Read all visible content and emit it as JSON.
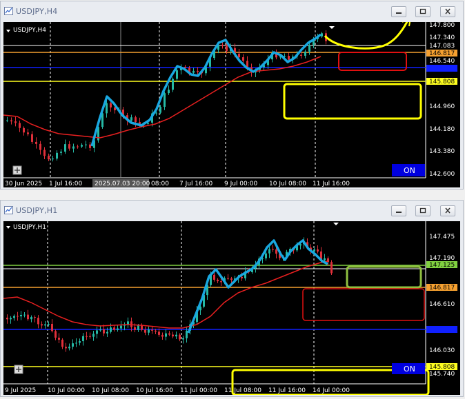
{
  "window1": {
    "title": "USDJPY,H4",
    "symbol": "USDJPY,H4",
    "on_badge": "ON",
    "price_labels": [
      "147.800",
      "147.340",
      "147.083",
      "146.817",
      "146.540",
      "145.808",
      "144.960",
      "144.180",
      "143.380",
      "142.600"
    ],
    "time_labels": [
      "30 Jun 2025",
      "1 Jul 16:00",
      "2025.07.03 20:00",
      "08:00",
      "7 Jul 16:00",
      "9 Jul 00:00",
      "10 Jul 08:00",
      "11 Jul 16:00"
    ]
  },
  "window2": {
    "title": "USDJPY,H1",
    "symbol": "USDJPY,H1",
    "on_badge": "ON",
    "price_labels": [
      "147.475",
      "147.190",
      "147.125",
      "146.817",
      "146.610",
      "146.030",
      "145.808",
      "145.740"
    ],
    "time_labels": [
      "9 Jul 2025",
      "10 Jul 00:00",
      "10 Jul 08:00",
      "10 Jul 16:00",
      "11 Jul 00:00",
      "11 Jul 08:00",
      "11 Jul 16:00",
      "14 Jul 00:00"
    ]
  },
  "colors": {
    "chart_bg": "#000000",
    "bull_candle": "#25b9a5",
    "bear_candle": "#e0303a",
    "moving_average": "#e82020",
    "orange_level": "#f5a030",
    "yellow_level": "#ffff20",
    "blue_level": "#1020ff",
    "green_level": "#80d040",
    "trend_drawing": "#19a7e0",
    "annotation_yellow": "#ffff00",
    "annotation_red": "#e01010",
    "annotation_green": "#90c040",
    "on_badge_bg": "#0000e0"
  }
}
